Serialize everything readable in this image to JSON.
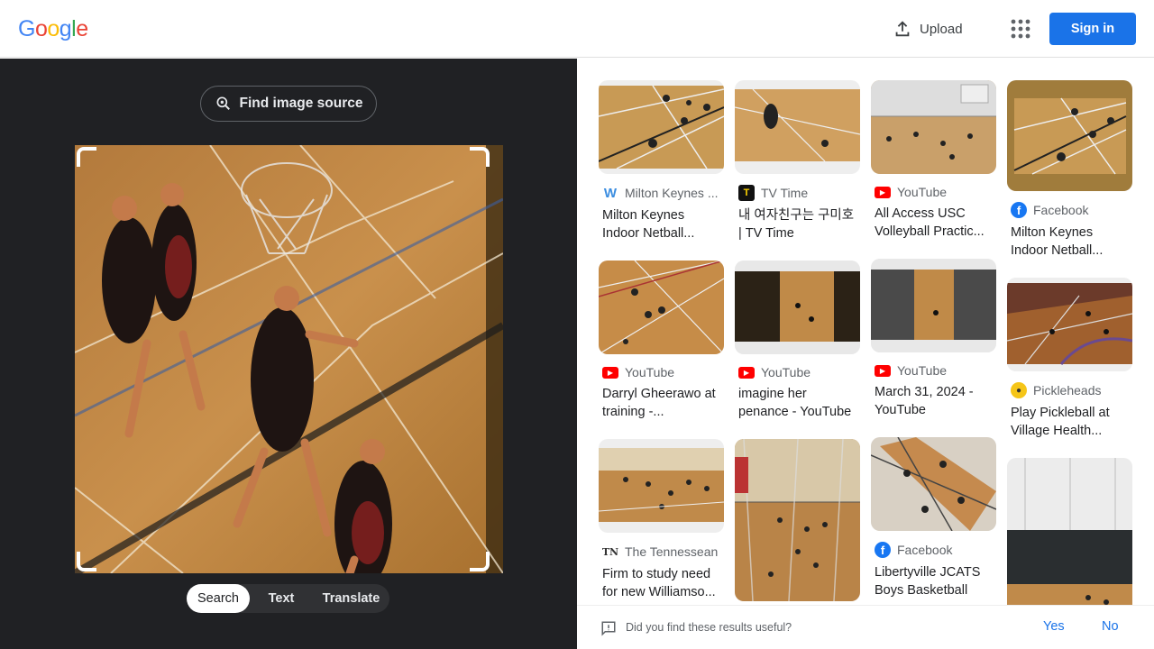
{
  "header": {
    "logo": [
      "G",
      "o",
      "o",
      "g",
      "l",
      "e"
    ],
    "logo_colors": [
      "#4285f4",
      "#ea4335",
      "#fbbc05",
      "#4285f4",
      "#34a853",
      "#ea4335"
    ],
    "upload_label": "Upload",
    "signin_label": "Sign in",
    "accent": "#1a73e8"
  },
  "left": {
    "find_source_label": "Find image source",
    "modes": [
      "Search",
      "Text",
      "Translate"
    ],
    "active_mode": "Search"
  },
  "results": [
    {
      "source": "Milton Keynes ...",
      "source_icon": "weebly-icon",
      "title": "Milton Keynes Indoor Netball..."
    },
    {
      "source": "TV Time",
      "source_icon": "tvtime-icon",
      "title": "내 여자친구는 구미호 | TV Time"
    },
    {
      "source": "YouTube",
      "source_icon": "youtube-icon",
      "title": "All Access USC Volleyball Practic..."
    },
    {
      "source": "Facebook",
      "source_icon": "facebook-icon",
      "title": "Milton Keynes Indoor Netball..."
    },
    {
      "source": "YouTube",
      "source_icon": "youtube-icon",
      "title": "Darryl Gheerawo at training -..."
    },
    {
      "source": "YouTube",
      "source_icon": "youtube-icon",
      "title": "imagine her penance - YouTube"
    },
    {
      "source": "YouTube",
      "source_icon": "youtube-icon",
      "title": "March 31, 2024 - YouTube"
    },
    {
      "source": "Pickleheads",
      "source_icon": "pickleheads-icon",
      "title": "Play Pickleball at Village Health..."
    },
    {
      "source": "The Tennessean",
      "source_icon": "tennessean-icon",
      "title": "Firm to study need for new Williamso..."
    },
    {
      "source": "Facebook",
      "source_icon": "facebook-icon",
      "title": "Libertyville JCATS Boys Basketball"
    }
  ],
  "feedback": {
    "question": "Did you find these results useful?",
    "yes_label": "Yes",
    "no_label": "No"
  }
}
